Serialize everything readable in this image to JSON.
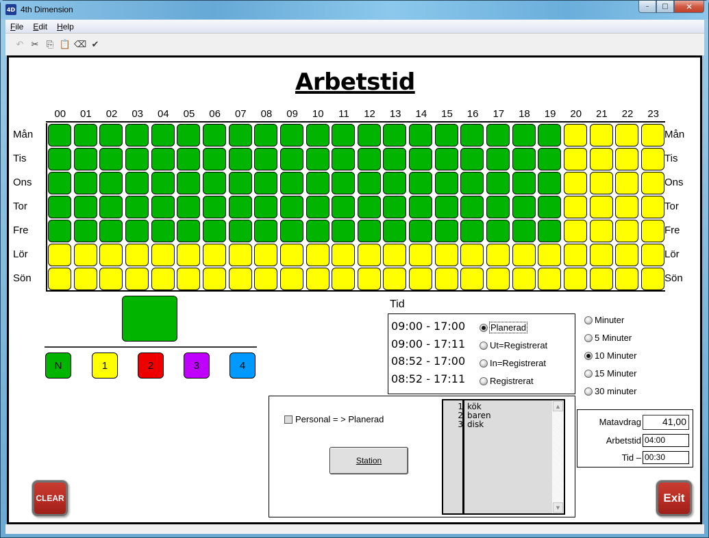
{
  "window": {
    "title": "4th Dimension",
    "icon": "app-gear-icon",
    "controls": {
      "minimize": "–",
      "maximize": "□",
      "close": "✕"
    }
  },
  "menu": {
    "items": [
      {
        "label": "File",
        "accel": "F"
      },
      {
        "label": "Edit",
        "accel": "E"
      },
      {
        "label": "Help",
        "accel": "H"
      }
    ]
  },
  "toolbar": {
    "icons": [
      {
        "name": "undo-icon",
        "glyph": "↶",
        "enabled": false
      },
      {
        "name": "cut-icon",
        "glyph": "✂",
        "enabled": true
      },
      {
        "name": "copy-icon",
        "glyph": "⎘",
        "enabled": true
      },
      {
        "name": "paste-icon",
        "glyph": "📋",
        "enabled": true
      },
      {
        "name": "eraser-icon",
        "glyph": "⌫",
        "enabled": true
      },
      {
        "name": "select-all-icon",
        "glyph": "✔",
        "enabled": true
      }
    ]
  },
  "page": {
    "title": "Arbetstid"
  },
  "schedule": {
    "hours": [
      "00",
      "01",
      "02",
      "03",
      "04",
      "05",
      "06",
      "07",
      "08",
      "09",
      "10",
      "11",
      "12",
      "13",
      "14",
      "15",
      "16",
      "17",
      "18",
      "19",
      "20",
      "21",
      "22",
      "23"
    ],
    "days": [
      "Mån",
      "Tis",
      "Ons",
      "Tor",
      "Fre",
      "Lör",
      "Sön"
    ],
    "colors": {
      "N": "#00b400",
      "1": "#ffff00",
      "2": "#ee0000",
      "3": "#c000ff",
      "4": "#0099ff"
    },
    "cells": [
      [
        "N",
        "N",
        "N",
        "N",
        "N",
        "N",
        "N",
        "N",
        "N",
        "N",
        "N",
        "N",
        "N",
        "N",
        "N",
        "N",
        "N",
        "N",
        "N",
        "N",
        "1",
        "1",
        "1",
        "1"
      ],
      [
        "N",
        "N",
        "N",
        "N",
        "N",
        "N",
        "N",
        "N",
        "N",
        "N",
        "N",
        "N",
        "N",
        "N",
        "N",
        "N",
        "N",
        "N",
        "N",
        "N",
        "1",
        "1",
        "1",
        "1"
      ],
      [
        "N",
        "N",
        "N",
        "N",
        "N",
        "N",
        "N",
        "N",
        "N",
        "N",
        "N",
        "N",
        "N",
        "N",
        "N",
        "N",
        "N",
        "N",
        "N",
        "N",
        "1",
        "1",
        "1",
        "1"
      ],
      [
        "N",
        "N",
        "N",
        "N",
        "N",
        "N",
        "N",
        "N",
        "N",
        "N",
        "N",
        "N",
        "N",
        "N",
        "N",
        "N",
        "N",
        "N",
        "N",
        "N",
        "1",
        "1",
        "1",
        "1"
      ],
      [
        "N",
        "N",
        "N",
        "N",
        "N",
        "N",
        "N",
        "N",
        "N",
        "N",
        "N",
        "N",
        "N",
        "N",
        "N",
        "N",
        "N",
        "N",
        "N",
        "N",
        "1",
        "1",
        "1",
        "1"
      ],
      [
        "1",
        "1",
        "1",
        "1",
        "1",
        "1",
        "1",
        "1",
        "1",
        "1",
        "1",
        "1",
        "1",
        "1",
        "1",
        "1",
        "1",
        "1",
        "1",
        "1",
        "1",
        "1",
        "1",
        "1"
      ],
      [
        "1",
        "1",
        "1",
        "1",
        "1",
        "1",
        "1",
        "1",
        "1",
        "1",
        "1",
        "1",
        "1",
        "1",
        "1",
        "1",
        "1",
        "1",
        "1",
        "1",
        "1",
        "1",
        "1",
        "1"
      ]
    ]
  },
  "palette": {
    "selected": "N",
    "swatches": [
      {
        "key": "N",
        "label": "N"
      },
      {
        "key": "1",
        "label": "1"
      },
      {
        "key": "2",
        "label": "2"
      },
      {
        "key": "3",
        "label": "3"
      },
      {
        "key": "4",
        "label": "4"
      }
    ]
  },
  "tid": {
    "label": "Tid",
    "rows": [
      {
        "range": "09:00 - 17:00",
        "option": "Planerad",
        "checked": true
      },
      {
        "range": "09:00 - 17:11",
        "option": "Ut=Registrerat",
        "checked": false
      },
      {
        "range": "08:52 - 17:00",
        "option": "In=Registrerat",
        "checked": false
      },
      {
        "range": "08:52 - 17:11",
        "option": "Registrerat",
        "checked": false
      }
    ]
  },
  "rounding": {
    "options": [
      {
        "label": "Minuter",
        "checked": false
      },
      {
        "label": "5 Minuter",
        "checked": false
      },
      {
        "label": "10 Minuter",
        "checked": true
      },
      {
        "label": "15 Minuter",
        "checked": false
      },
      {
        "label": "30 minuter",
        "checked": false
      }
    ]
  },
  "station_panel": {
    "checkbox_label": "Personal = > Planerad",
    "checkbox_checked": false,
    "station_button": "Station",
    "list": [
      {
        "num": "1",
        "text": "kök"
      },
      {
        "num": "2",
        "text": "baren"
      },
      {
        "num": "3",
        "text": "disk"
      }
    ]
  },
  "summary": {
    "matavdrag_label": "Matavdrag",
    "matavdrag_value": "41,00",
    "arbetstid_label": "Arbetstid",
    "arbetstid_value": "04:00",
    "tid_label": "Tid –",
    "tid_value": "00:30"
  },
  "buttons": {
    "clear": "CLEAR",
    "exit": "Exit"
  }
}
